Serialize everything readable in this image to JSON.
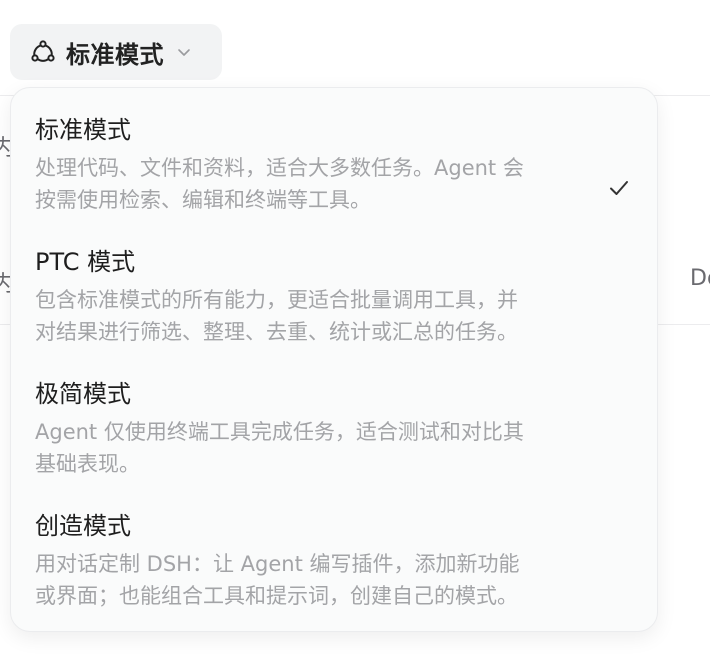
{
  "selector": {
    "current_label": "标准模式"
  },
  "background": {
    "left_fragment_1": "内",
    "left_fragment_2": "内",
    "right_fragment": "Do"
  },
  "menu": {
    "items": [
      {
        "title": "标准模式",
        "desc_line1": "处理代码、文件和资料，适合大多数任务。Agent 会",
        "desc_line2": "按需使用检索、编辑和终端等工具。",
        "selected": true
      },
      {
        "title": "PTC 模式",
        "desc_line1": "包含标准模式的所有能力，更适合批量调用工具，并",
        "desc_line2": "对结果进行筛选、整理、去重、统计或汇总的任务。",
        "selected": false
      },
      {
        "title": "极简模式",
        "desc_line1": "Agent 仅使用终端工具完成任务，适合测试和对比其",
        "desc_line2": "基础表现。",
        "selected": false
      },
      {
        "title": "创造模式",
        "desc_line1": "用对话定制 DSH：让 Agent 编写插件，添加新功能",
        "desc_line2": "或界面；也能组合工具和提示词，创建自己的模式。",
        "selected": false
      }
    ]
  },
  "icons": {
    "selector_icon": "mode-nodes-icon",
    "selector_chevron": "chevron-down-icon",
    "selected_mark": "checkmark-icon"
  },
  "colors": {
    "button_bg": "#f2f3f4",
    "menu_bg": "#fafbfb",
    "title_text": "#1e1e1e",
    "desc_text": "#a3a4a7"
  }
}
